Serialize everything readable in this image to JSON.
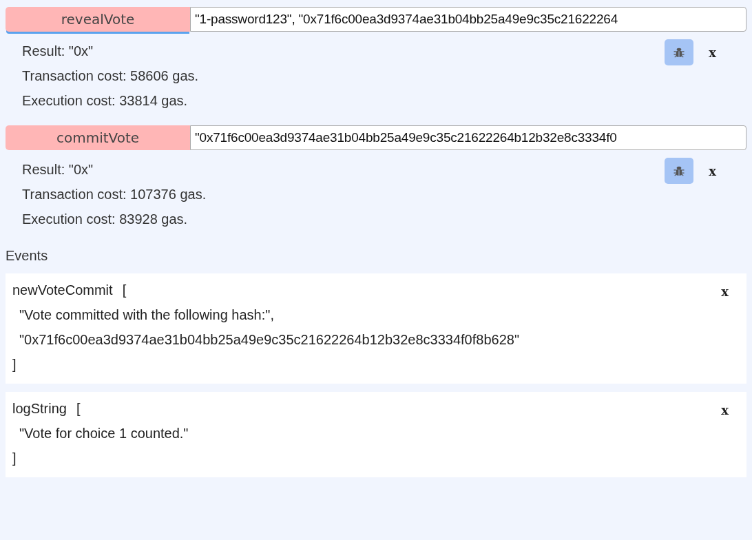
{
  "calls": [
    {
      "function": "revealVote",
      "focused": true,
      "args": "\"1-password123\", \"0x71f6c00ea3d9374ae31b04bb25a49e9c35c21622264",
      "result": [
        "Result: \"0x\"",
        "Transaction cost: 58606 gas.",
        "Execution cost: 33814 gas."
      ],
      "close": "x"
    },
    {
      "function": "commitVote",
      "focused": false,
      "args": "\"0x71f6c00ea3d9374ae31b04bb25a49e9c35c21622264b12b32e8c3334f0",
      "result": [
        "Result: \"0x\"",
        "Transaction cost: 107376 gas.",
        "Execution cost: 83928 gas."
      ],
      "close": "x"
    }
  ],
  "events_heading": "Events",
  "events": [
    {
      "name": "newVoteCommit",
      "open": "[",
      "lines": [
        "\"Vote committed with the following hash:\",",
        "\"0x71f6c00ea3d9374ae31b04bb25a49e9c35c21622264b12b32e8c3334f0f8b628\""
      ],
      "end": "]",
      "close": "x"
    },
    {
      "name": "logString",
      "open": "[",
      "lines": [
        "\"Vote for choice 1 counted.\""
      ],
      "end": "]",
      "close": "x"
    }
  ]
}
